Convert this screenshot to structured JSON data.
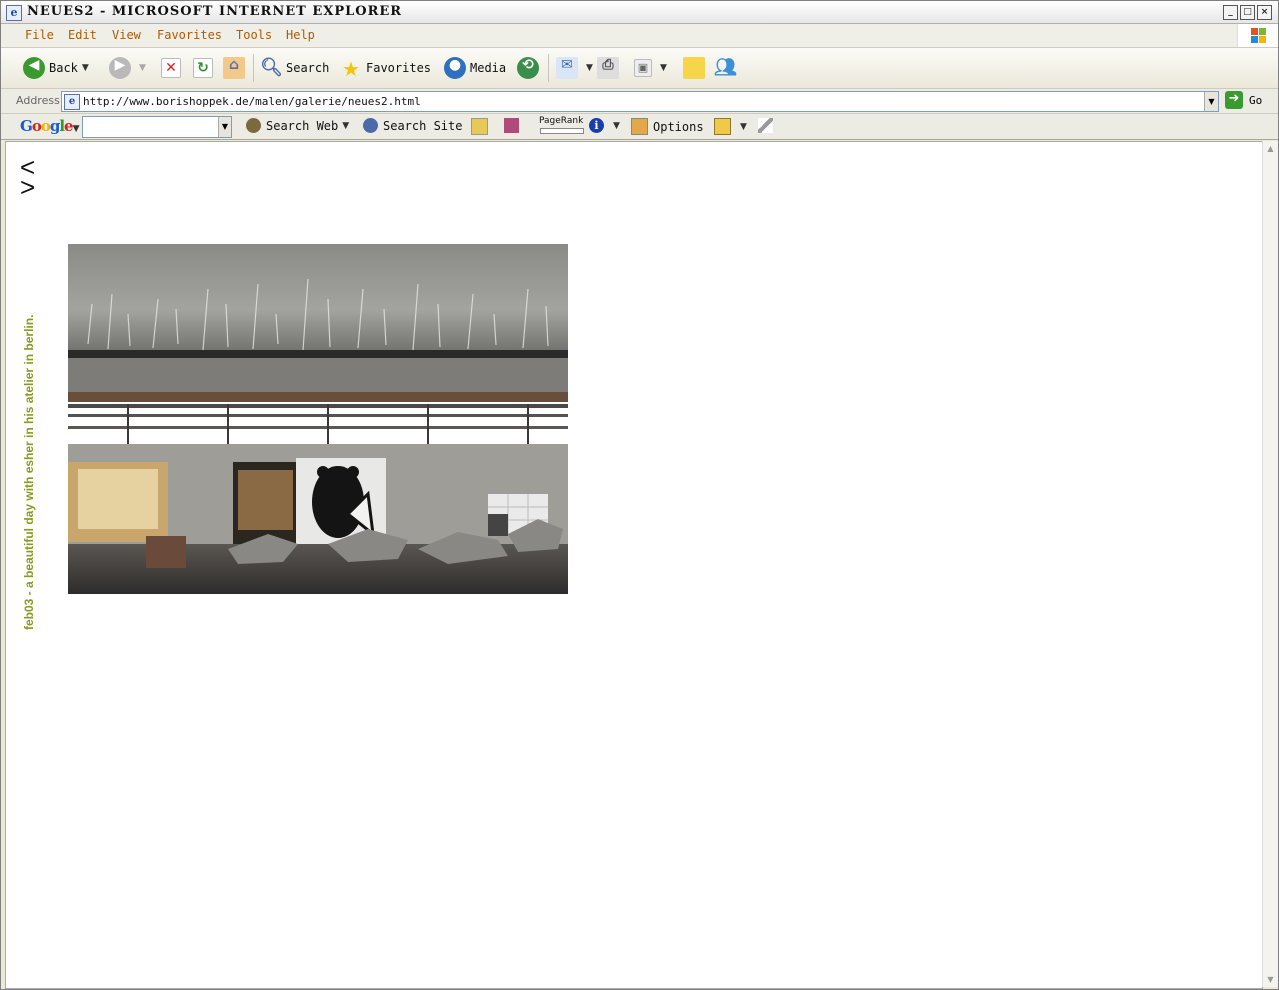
{
  "window": {
    "title": "neues2 - Microsoft Internet Explorer",
    "controls": [
      "minimize",
      "maximize",
      "close"
    ]
  },
  "menu": [
    "File",
    "Edit",
    "View",
    "Favorites",
    "Tools",
    "Help"
  ],
  "toolbar": {
    "back": "Back",
    "search": "Search",
    "favorites": "Favorites",
    "media": "Media"
  },
  "address": {
    "label": "Address",
    "url": "http://www.borishoppek.de/malen/galerie/neues2.html",
    "go": "Go"
  },
  "google": {
    "logo": "Google",
    "search_web": "Search Web",
    "search_site": "Search Site",
    "pagerank": "PageRank",
    "options": "Options"
  },
  "page": {
    "nav_prev": "<",
    "nav_next": ">",
    "caption": "feb03 - a beautiful day with esher in his atelier in berlin.",
    "caption_color": "#8a9a1f"
  },
  "colors": {
    "menu_text": "#b05a00",
    "go_green": "#3a9a2f"
  }
}
